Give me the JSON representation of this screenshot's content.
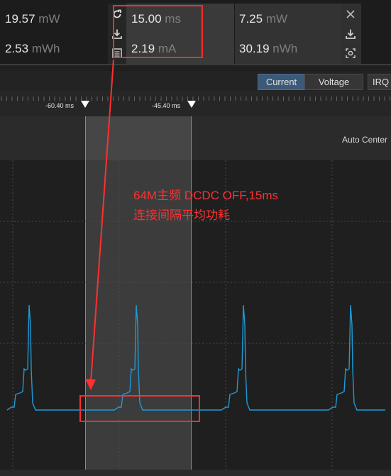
{
  "stats": {
    "left": {
      "power": {
        "value": "19.57",
        "unit": "mW"
      },
      "energy": {
        "value": "2.53",
        "unit": "mWh"
      }
    },
    "window": {
      "duration": {
        "value": "15.00",
        "unit": "ms"
      },
      "current": {
        "value": "2.19",
        "unit": "mA"
      }
    },
    "right": {
      "power": {
        "value": "7.25",
        "unit": "mW"
      },
      "energy": {
        "value": "30.19",
        "unit": "nWh"
      }
    }
  },
  "toolbar": {
    "current_label": "Current",
    "voltage_label": "Voltage",
    "irq_label": "IRQ"
  },
  "markers": {
    "left": "-60.40 ms",
    "right": "-45.40 ms"
  },
  "auto_center_label": "Auto Center",
  "annotation": {
    "line1": "64M主频 DCDC OFF,15ms",
    "line2": "连接间隔平均功耗"
  },
  "colors": {
    "trace": "#1e9ad6",
    "annotation": "#ff3030",
    "active_segment": "#3c5a78"
  },
  "icons": [
    "reset-icon",
    "save-icon",
    "list-icon",
    "close-icon",
    "save-icon",
    "screenshot-icon",
    "marker-icon"
  ]
}
